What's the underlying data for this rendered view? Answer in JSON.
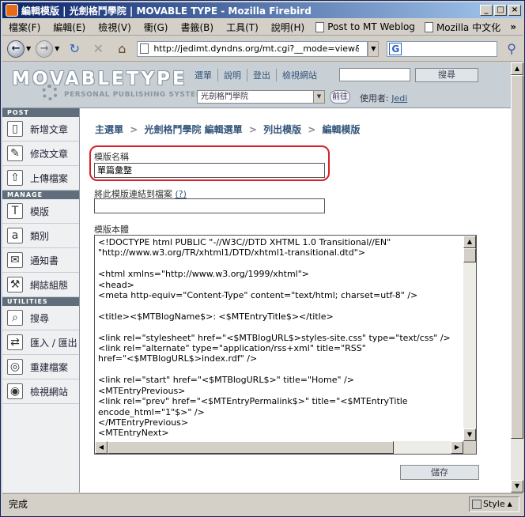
{
  "window": {
    "title": "編輯模版 | 光劍格鬥學院 | MOVABLE TYPE - Mozilla Firebird",
    "minimize": "_",
    "maximize": "□",
    "close": "×"
  },
  "menubar": {
    "items": [
      "檔案(F)",
      "編輯(E)",
      "檢視(V)",
      "衝(G)",
      "書籤(B)",
      "工具(T)",
      "說明(H)"
    ],
    "bookmarks": [
      "Post to MT Weblog",
      "Mozilla 中文化"
    ],
    "more": "»"
  },
  "navbar": {
    "url": "http://jedimt.dyndns.org/mt.cgi?__mode=view&_typ",
    "search_letter": "G"
  },
  "mt": {
    "logo": "MOVABLETYPE",
    "tagline": "PERSONAL PUBLISHING SYSTEM",
    "nav": [
      "選單",
      "說明",
      "登出",
      "檢視網站"
    ],
    "search_button": "搜尋",
    "blog_select": "光劍格鬥學院",
    "go_button": "前往",
    "user_label": "使用者:",
    "user_name": "Jedi"
  },
  "sidebar": {
    "sections": [
      {
        "title": "POST",
        "items": [
          {
            "label": "新增文章",
            "icon": "new-entry-icon",
            "glyph": "▯"
          },
          {
            "label": "修改文章",
            "icon": "edit-entries-icon",
            "glyph": "✎"
          },
          {
            "label": "上傳檔案",
            "icon": "upload-file-icon",
            "glyph": "⇧"
          }
        ]
      },
      {
        "title": "MANAGE",
        "items": [
          {
            "label": "模版",
            "icon": "templates-icon",
            "glyph": "T"
          },
          {
            "label": "類別",
            "icon": "categories-icon",
            "glyph": "a"
          },
          {
            "label": "通知書",
            "icon": "notifications-icon",
            "glyph": "✉"
          },
          {
            "label": "網誌組態",
            "icon": "weblog-config-icon",
            "glyph": "⚒"
          }
        ]
      },
      {
        "title": "UTILITIES",
        "items": [
          {
            "label": "搜尋",
            "icon": "search-icon",
            "glyph": "⌕"
          },
          {
            "label": "匯入 / 匯出",
            "icon": "import-export-icon",
            "glyph": "⇄"
          },
          {
            "label": "重建檔案",
            "icon": "rebuild-icon",
            "glyph": "◎"
          },
          {
            "label": "檢視網站",
            "icon": "view-site-icon",
            "glyph": "◉"
          }
        ]
      }
    ]
  },
  "breadcrumb": [
    "主選單",
    "光劍格鬥學院 編輯選單",
    "列出模版",
    "編輯模版"
  ],
  "breadcrumb_sep": ">",
  "form": {
    "name_label": "模版名稱",
    "name_value": "單篇彙整",
    "link_label": "將此模版連結到檔案",
    "link_help": "(?)",
    "link_value": "",
    "body_label": "模版本體",
    "body_text": "<!DOCTYPE html PUBLIC \"-//W3C//DTD XHTML 1.0 Transitional//EN\"\n\"http://www.w3.org/TR/xhtml1/DTD/xhtml1-transitional.dtd\">\n\n<html xmlns=\"http://www.w3.org/1999/xhtml\">\n<head>\n<meta http-equiv=\"Content-Type\" content=\"text/html; charset=utf-8\" />\n\n<title><$MTBlogName$>: <$MTEntryTitle$></title>\n\n<link rel=\"stylesheet\" href=\"<$MTBlogURL$>styles-site.css\" type=\"text/css\" />\n<link rel=\"alternate\" type=\"application/rss+xml\" title=\"RSS\"\nhref=\"<$MTBlogURL$>index.rdf\" />\n\n<link rel=\"start\" href=\"<$MTBlogURL$>\" title=\"Home\" />\n<MTEntryPrevious>\n<link rel=\"prev\" href=\"<$MTEntryPermalink$>\" title=\"<$MTEntryTitle\nencode_html=\"1\"$>\" />\n</MTEntryPrevious>\n<MTEntryNext>",
    "save_button": "儲存"
  },
  "statusbar": {
    "text": "完成",
    "style_label": "Style"
  },
  "colors": {
    "title_bar": "#0a246a",
    "highlight": "#d4222a",
    "link": "#33557a"
  }
}
